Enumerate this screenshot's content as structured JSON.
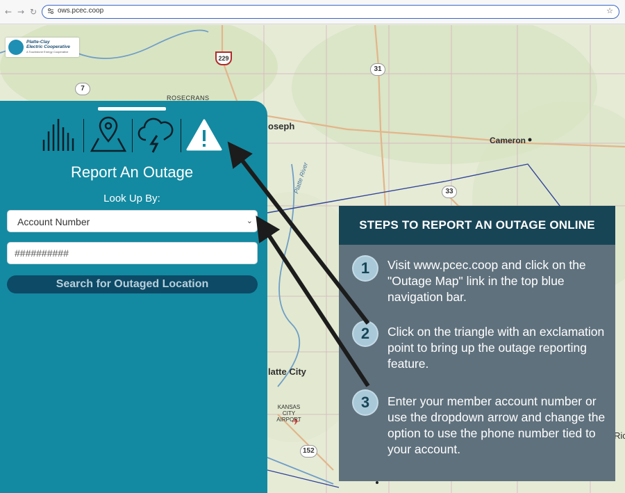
{
  "browser": {
    "back_icon": "back-arrow-icon",
    "forward_icon": "forward-arrow-icon",
    "reload_icon": "reload-icon",
    "url": "ows.pcec.coop",
    "bookmark_icon": "star-icon"
  },
  "logo": {
    "line1": "Platte-Clay",
    "line2": "Electric Cooperative",
    "line3": "A Touchstone Energy Cooperative"
  },
  "map": {
    "labels": {
      "joseph": "oseph",
      "cameron": "Cameron",
      "platte_city": "latte City",
      "rosecrans": "ROSECRANS",
      "platte_river": "Platte River",
      "kansas_city_airport": "KANSAS CITY AIRPORT",
      "ric": "Ric"
    },
    "shields": {
      "i229": "229",
      "r31": "31",
      "r7": "7",
      "r33": "33",
      "r152": "152"
    }
  },
  "panel": {
    "tools": [
      "chart-bars-icon",
      "map-pin-icon",
      "storm-cloud-icon",
      "warning-triangle-icon"
    ],
    "title": "Report An Outage",
    "lookup_label": "Look Up By:",
    "lookup_selected": "Account Number",
    "account_placeholder": "##########",
    "search_button": "Search for Outaged Location"
  },
  "steps": {
    "heading": "STEPS TO REPORT AN OUTAGE ONLINE",
    "items": [
      {
        "num": "1",
        "text": "Visit www.pcec.coop and click on the \"Outage Map\" link in the top blue navigation bar."
      },
      {
        "num": "2",
        "text": "Click on the triangle with an exclamation point to bring up the outage reporting feature."
      },
      {
        "num": "3",
        "text": "Enter your member account number or use the dropdown arrow and change the option to use the phone number tied to your account."
      }
    ]
  },
  "colors": {
    "panel": "#138aa1",
    "steps_bg": "#5f717d",
    "steps_head": "#174556",
    "button": "#0c4a66"
  }
}
